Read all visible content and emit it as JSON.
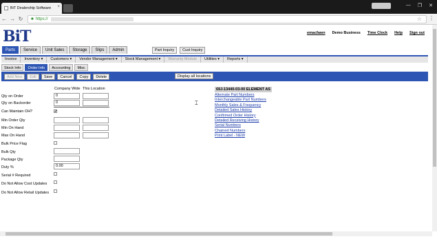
{
  "browser": {
    "tab_title": "BiT Dealership Software",
    "url_scheme": "https://",
    "tab_close": "×",
    "new_tab": "+",
    "back": "←",
    "forward": "→",
    "reload": "↻",
    "star": "☆",
    "menu": "⋮",
    "window": {
      "minimize": "—",
      "maximize": "❐",
      "close": "✕"
    }
  },
  "app": {
    "logo": "BiT",
    "toplinks": [
      "emacfawn",
      "Demo Business",
      "Time Clock",
      "Help",
      "Sign out"
    ],
    "main_nav": [
      "Parts",
      "Service",
      "Unit Sales",
      "Storage",
      "Slips",
      "Admin"
    ],
    "main_nav_active": "Parts",
    "inquiry_buttons": [
      "Part Inquiry",
      "Cust Inquiry"
    ],
    "sub_nav": [
      "Invoice",
      "Inventory ▾",
      "Customers ▾",
      "Vendor Management ▾",
      "Stock Management ▾",
      "Warranty Module",
      "Utilities ▾",
      "Reports ▾"
    ],
    "tabs": [
      "Stock Info",
      "Order Info",
      "Accounting",
      "Misc"
    ],
    "active_tab": "Order Info",
    "actions": [
      "Add New",
      "Edit",
      "Save",
      "Cancel",
      "Copy",
      "Delete"
    ],
    "display_all": "Display all locations"
  },
  "form": {
    "col_company": "Company Wide",
    "col_location": "This Location",
    "qty_on_order": {
      "label": "Qty on Order",
      "company": "0",
      "location": ""
    },
    "qty_on_backorder": {
      "label": "Qty on Backorder",
      "company": "0",
      "location": ""
    },
    "can_maintain_oh": {
      "label": "Can Maintain OH?",
      "checked": "✔"
    },
    "min_order_qty": {
      "label": "Min Order Qty"
    },
    "min_on_hand": {
      "label": "Min On Hand"
    },
    "max_on_hand": {
      "label": "Max On Hand"
    },
    "bulk_price_flag": {
      "label": "Bulk Price Flag"
    },
    "bulk_qty": {
      "label": "Bulk Qty"
    },
    "package_qty": {
      "label": "Package Qty"
    },
    "duty_pct": {
      "label": "Duty %",
      "value": "0.00"
    },
    "serial_required": {
      "label": "Serial # Required"
    },
    "no_cost_updates": {
      "label": "Do Not Allow Cost Updates"
    },
    "no_retail_updates": {
      "label": "Do Not Allow Retail Updates"
    }
  },
  "right_panel": {
    "element_header": "69J-13440-03-00  ELEMENT AS",
    "links": [
      "Alternate Part Numbers",
      "Interchangeable Part Numbers",
      "Monthly Sales & Frequency",
      "Detailed Sales History",
      "Confirmed Order History",
      "Detailed Receiving History",
      "Serial Numbers",
      "Chained Numbers",
      "Print Label - NEW"
    ]
  }
}
